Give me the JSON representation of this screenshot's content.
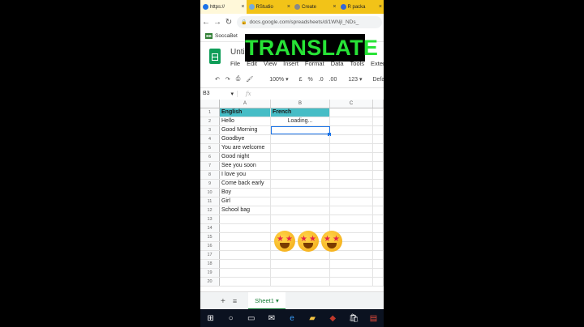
{
  "browser": {
    "tabs": [
      {
        "label": "https://",
        "favicon_color": "#1a73e8"
      },
      {
        "label": "RStudio",
        "favicon_color": "#75aadb"
      },
      {
        "label": "Create",
        "favicon_color": "#888888"
      },
      {
        "label": "R packa",
        "favicon_color": "#3367d6"
      }
    ],
    "url": "docs.google.com/spreadsheets/d/1WNjI_NDs_",
    "bookmark": "SoccaBet",
    "bookmark_badge": "BB"
  },
  "doc": {
    "title": "Unti",
    "menu": [
      "File",
      "Edit",
      "View",
      "Insert",
      "Format",
      "Data",
      "Tools",
      "Extens"
    ]
  },
  "caption": "TRANSLATE",
  "toolbar": {
    "zoom": "100%",
    "currency": "£",
    "percent": "%",
    "dec_less": ".0",
    "dec_more": ".00",
    "number_format": "123",
    "font": "Default"
  },
  "formula_bar": {
    "name_box": "B3",
    "fx": "fx"
  },
  "grid": {
    "columns": [
      "A",
      "B",
      "C"
    ],
    "rows": [
      {
        "num": "1",
        "a": "English",
        "b": "French"
      },
      {
        "num": "2",
        "a": "Hello",
        "b": "Loading..."
      },
      {
        "num": "3",
        "a": "Good Morning",
        "b": ""
      },
      {
        "num": "4",
        "a": "Goodbye",
        "b": ""
      },
      {
        "num": "5",
        "a": "You are welcome",
        "b": ""
      },
      {
        "num": "6",
        "a": "Good night",
        "b": ""
      },
      {
        "num": "7",
        "a": "See you soon",
        "b": ""
      },
      {
        "num": "8",
        "a": "I love you",
        "b": ""
      },
      {
        "num": "9",
        "a": "Come back early",
        "b": ""
      },
      {
        "num": "10",
        "a": "Boy",
        "b": ""
      },
      {
        "num": "11",
        "a": "Girl",
        "b": ""
      },
      {
        "num": "12",
        "a": "School bag",
        "b": ""
      },
      {
        "num": "13",
        "a": "",
        "b": ""
      },
      {
        "num": "14",
        "a": "",
        "b": ""
      },
      {
        "num": "15",
        "a": "",
        "b": ""
      },
      {
        "num": "16",
        "a": "",
        "b": ""
      },
      {
        "num": "17",
        "a": "",
        "b": ""
      },
      {
        "num": "18",
        "a": "",
        "b": ""
      },
      {
        "num": "19",
        "a": "",
        "b": ""
      },
      {
        "num": "20",
        "a": "",
        "b": ""
      }
    ],
    "header_color": "#46bdc6"
  },
  "sheets": {
    "active": "Sheet1"
  },
  "colors": {
    "accent": "#1a73e8",
    "sheets_green": "#188038",
    "caption_green": "#27e336"
  }
}
